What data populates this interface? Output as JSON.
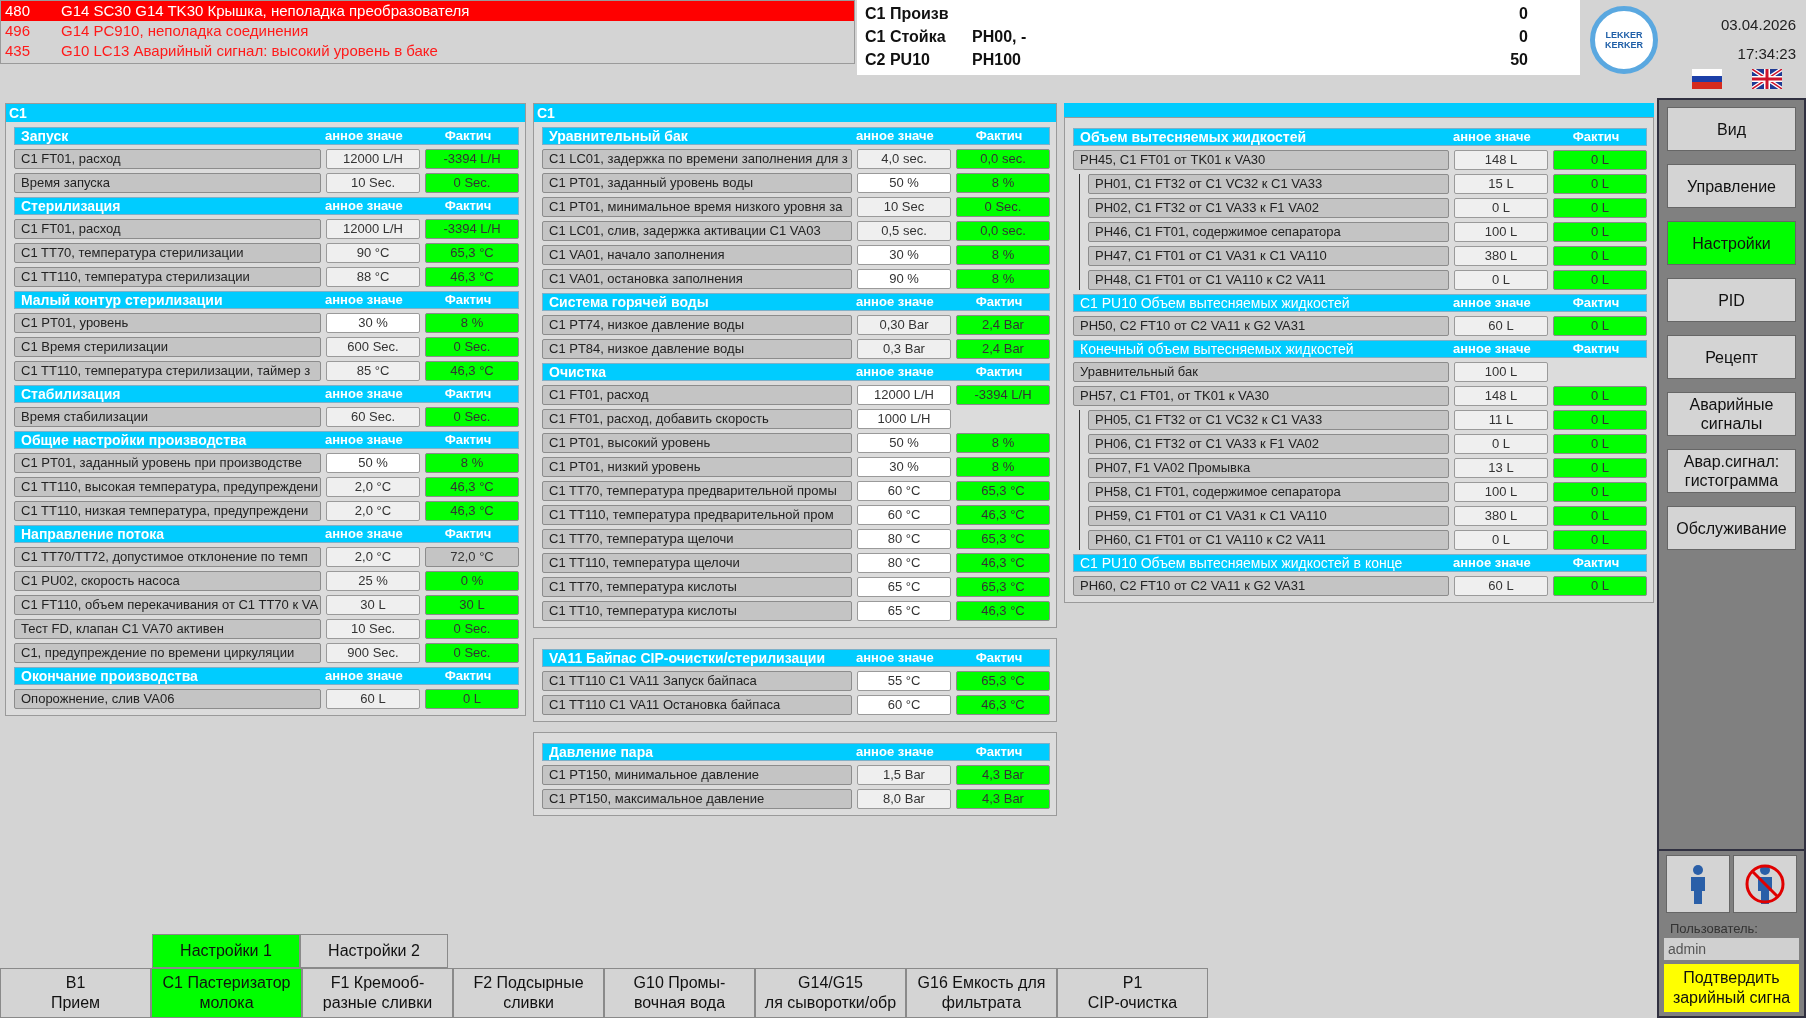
{
  "alarms": [
    {
      "code": "480",
      "text": "G14 SC30 G14 TK30 Крышка, неполадка преобразователя",
      "active": true
    },
    {
      "code": "496",
      "text": "G14 PC910, неполадка соединения",
      "active": false
    },
    {
      "code": "435",
      "text": "G10 LC13 Аварийный сигнал: высокий уровень в баке",
      "active": false
    }
  ],
  "info": [
    {
      "label": "C1 Произв",
      "number": "0"
    },
    {
      "label": "C1 Стойка",
      "value": "PH00, -",
      "number": "0"
    },
    {
      "label": "C2 PU10",
      "value": "PH100",
      "number": "50"
    }
  ],
  "logo": "LEKKER\nKERKER",
  "date": "03.04.2026",
  "time": "17:34:23",
  "columns": [
    [
      {
        "title": "C1",
        "sections": [
          {
            "title": "Запуск",
            "kind": "main",
            "col_set": "анное значе",
            "col_actual": "Фактич",
            "rows": [
              {
                "label": "C1 FT01, расход",
                "set": "12000 L/H",
                "editable": false,
                "actual": "-3394 L/H",
                "ok": true
              },
              {
                "label": "Время запуска",
                "set": "10 Sec.",
                "editable": false,
                "actual": "0 Sec.",
                "ok": true
              }
            ]
          },
          {
            "title": "Стерилизация",
            "kind": "main",
            "col_set": "анное значе",
            "col_actual": "Фактич",
            "rows": [
              {
                "label": "C1 FT01, расход",
                "set": "12000 L/H",
                "editable": false,
                "actual": "-3394 L/H",
                "ok": true
              },
              {
                "label": "C1 TT70, температура стерилизации",
                "set": "90 °C",
                "editable": false,
                "actual": "65,3 °C",
                "ok": true
              },
              {
                "label": "C1 TT110, температура стерилизации",
                "set": "88 °C",
                "editable": false,
                "actual": "46,3 °C",
                "ok": true
              }
            ]
          },
          {
            "title": "Малый контур стерилизации",
            "kind": "main",
            "col_set": "анное значе",
            "col_actual": "Фактич",
            "rows": [
              {
                "label": "C1 PT01, уровень",
                "set": "30 %",
                "editable": true,
                "actual": "8 %",
                "ok": true
              },
              {
                "label": "C1 Время стерилизации",
                "set": "600 Sec.",
                "editable": false,
                "actual": "0 Sec.",
                "ok": true
              },
              {
                "label": "C1 TT110, температура стерилизации, таймер з",
                "set": "85 °C",
                "editable": false,
                "actual": "46,3 °C",
                "ok": true
              }
            ]
          },
          {
            "title": "Стабилизация",
            "kind": "main",
            "col_set": "анное значе",
            "col_actual": "Фактич",
            "rows": [
              {
                "label": "Время стабилизации",
                "set": "60 Sec.",
                "editable": false,
                "actual": "0 Sec.",
                "ok": true
              }
            ]
          },
          {
            "title": "Общие настройки производства",
            "kind": "main",
            "col_set": "анное значе",
            "col_actual": "Фактич",
            "rows": [
              {
                "label": "C1 PT01, заданный уровень при производстве",
                "set": "50 %",
                "editable": true,
                "actual": "8 %",
                "ok": true
              },
              {
                "label": "C1 TT110, высокая температура, предупреждени",
                "set": "2,0 °C",
                "editable": false,
                "actual": "46,3 °C",
                "ok": true
              },
              {
                "label": "C1 TT110, низкая температура, предупреждени",
                "set": "2,0 °C",
                "editable": false,
                "actual": "46,3 °C",
                "ok": true
              }
            ]
          },
          {
            "title": "Направление потока",
            "kind": "main",
            "col_set": "анное значе",
            "col_actual": "Фактич",
            "rows": [
              {
                "label": "C1 TT70/TT72, допустимое отклонение по темп",
                "set": "2,0 °C",
                "editable": false,
                "actual": "72,0 °C",
                "ok": false
              },
              {
                "label": "C1 PU02, скорость насоса",
                "set": "25 %",
                "editable": false,
                "actual": "0 %",
                "ok": true
              },
              {
                "label": "C1 FT110, объем перекачивания от C1 TT70 к VA",
                "set": "30 L",
                "editable": false,
                "actual": "30 L",
                "ok": true
              },
              {
                "label": "Тест FD, клапан C1 VA70 активен",
                "set": "10 Sec.",
                "editable": false,
                "actual": "0 Sec.",
                "ok": true
              },
              {
                "label": "C1, предупреждение по времени циркуляции",
                "set": "900 Sec.",
                "editable": false,
                "actual": "0 Sec.",
                "ok": true
              }
            ]
          },
          {
            "title": "Окончание производства",
            "kind": "main",
            "col_set": "анное значе",
            "col_actual": "Фактич",
            "rows": [
              {
                "label": "Опорожнение, слив VA06",
                "set": "60 L",
                "editable": false,
                "actual": "0 L",
                "ok": true
              }
            ]
          }
        ]
      }
    ],
    [
      {
        "title": "C1",
        "sections": [
          {
            "title": "Уравнительный бак",
            "kind": "main",
            "col_set": "анное значе",
            "col_actual": "Фактич",
            "rows": [
              {
                "label": "C1 LC01, задержка по времени заполнения для з",
                "set": "4,0 sec.",
                "editable": false,
                "actual": "0,0 sec.",
                "ok": true
              },
              {
                "label": "C1 PT01, заданный уровень воды",
                "set": "50 %",
                "editable": true,
                "actual": "8 %",
                "ok": true
              },
              {
                "label": "C1 PT01, минимальное время низкого уровня за",
                "set": "10 Sec",
                "editable": false,
                "actual": "0 Sec.",
                "ok": true
              },
              {
                "label": "C1 LC01, слив, задержка активации C1 VA03",
                "set": "0,5 sec.",
                "editable": false,
                "actual": "0,0 sec.",
                "ok": true
              },
              {
                "label": "C1 VA01, начало заполнения",
                "set": "30 %",
                "editable": true,
                "actual": "8 %",
                "ok": true
              },
              {
                "label": "C1 VA01, остановка заполнения",
                "set": "90 %",
                "editable": true,
                "actual": "8 %",
                "ok": true
              }
            ]
          },
          {
            "title": "Система горячей воды",
            "kind": "main",
            "col_set": "анное значе",
            "col_actual": "Фактич",
            "rows": [
              {
                "label": "C1 PT74, низкое давление воды",
                "set": "0,30 Bar",
                "editable": false,
                "actual": "2,4 Bar",
                "ok": true
              },
              {
                "label": "C1 PT84, низкое давление воды",
                "set": "0,3 Bar",
                "editable": false,
                "actual": "2,4 Bar",
                "ok": true
              }
            ]
          },
          {
            "title": "Очистка",
            "kind": "main",
            "col_set": "анное значе",
            "col_actual": "Фактич",
            "rows": [
              {
                "label": "C1 FT01, расход",
                "set": "12000 L/H",
                "editable": true,
                "actual": "-3394 L/H",
                "ok": true
              },
              {
                "label": "C1 FT01, расход, добавить скорость",
                "set": "1000 L/H",
                "editable": true
              },
              {
                "label": "C1 PT01, высокий уровень",
                "set": "50 %",
                "editable": true,
                "actual": "8 %",
                "ok": true
              },
              {
                "label": "C1 PT01, низкий уровень",
                "set": "30 %",
                "editable": true,
                "actual": "8 %",
                "ok": true
              },
              {
                "label": "C1 TT70, температура предварительной промы",
                "set": "60 °C",
                "editable": true,
                "actual": "65,3 °C",
                "ok": true
              },
              {
                "label": "C1 TT110, температура предварительной пром",
                "set": "60 °C",
                "editable": true,
                "actual": "46,3 °C",
                "ok": true
              },
              {
                "label": "C1 TT70, температура щелочи",
                "set": "80 °C",
                "editable": true,
                "actual": "65,3 °C",
                "ok": true
              },
              {
                "label": "C1 TT110, температура щелочи",
                "set": "80 °C",
                "editable": true,
                "actual": "46,3 °C",
                "ok": true
              },
              {
                "label": "C1 TT70, температура кислоты",
                "set": "65 °C",
                "editable": true,
                "actual": "65,3 °C",
                "ok": true
              },
              {
                "label": "C1 TT10, температура кислоты",
                "set": "65 °C",
                "editable": true,
                "actual": "46,3 °C",
                "ok": true
              }
            ]
          }
        ]
      },
      {
        "sections": [
          {
            "title": "VA11 Байпас CIP-очистки/стерилизации",
            "kind": "main",
            "col_set": "анное значе",
            "col_actual": "Фактич",
            "rows": [
              {
                "label": "C1 TT110 C1 VA11 Запуск байпаса",
                "set": "55 °C",
                "editable": true,
                "actual": "65,3 °C",
                "ok": true
              },
              {
                "label": "C1 TT110 C1 VA11 Остановка байпаса",
                "set": "60 °C",
                "editable": true,
                "actual": "46,3 °C",
                "ok": true
              }
            ]
          }
        ]
      },
      {
        "sections": [
          {
            "title": "Давление пара",
            "kind": "main",
            "col_set": "анное значе",
            "col_actual": "Фактич",
            "rows": [
              {
                "label": "C1 PT150, минимальное давление",
                "set": "1,5 Bar",
                "editable": false,
                "actual": "4,3 Bar",
                "ok": true
              },
              {
                "label": "C1 PT150, максимальное давление",
                "set": "8,0 Bar",
                "editable": false,
                "actual": "4,3 Bar",
                "ok": true
              }
            ]
          }
        ]
      }
    ],
    [
      {
        "sections": [
          {
            "title": "Объем вытесняемых жидкостей",
            "kind": "main",
            "col_set": "анное значе",
            "col_actual": "Фактич",
            "rows": [
              {
                "label": "PH45, C1 FT01 от TK01 к VA30",
                "set": "148 L",
                "editable": false,
                "actual": "0 L",
                "ok": true,
                "children": [
                  {
                    "label": "PH01, C1 FT32 от C1 VC32 к C1 VA33",
                    "set": "15 L",
                    "editable": false,
                    "actual": "0 L",
                    "ok": true
                  },
                  {
                    "label": "PH02, C1 FT32 от C1 VA33 к F1 VA02",
                    "set": "0 L",
                    "editable": false,
                    "actual": "0 L",
                    "ok": true
                  },
                  {
                    "label": "PH46, C1 FT01, содержимое сепаратора",
                    "set": "100 L",
                    "editable": false,
                    "actual": "0 L",
                    "ok": true
                  },
                  {
                    "label": "PH47, C1 FT01 от C1 VA31 к C1 VA110",
                    "set": "380 L",
                    "editable": false,
                    "actual": "0 L",
                    "ok": true
                  },
                  {
                    "label": "PH48, C1 FT01 от C1 VA110 к C2 VA11",
                    "set": "0 L",
                    "editable": false,
                    "actual": "0 L",
                    "ok": true
                  }
                ]
              }
            ]
          },
          {
            "title": "C1 PU10 Объем вытесняемых жидкостей",
            "kind": "sub",
            "col_set": "анное значе",
            "col_actual": "Фактич",
            "rows": [
              {
                "label": "PH50, C2 FT10 от C2 VA11 к G2 VA31",
                "set": "60 L",
                "editable": false,
                "actual": "0 L",
                "ok": true
              }
            ]
          },
          {
            "title": "Конечный объем вытесняемых жидкостей",
            "kind": "sub",
            "col_set": "анное значе",
            "col_actual": "Фактич",
            "rows": [
              {
                "label": "Уравнительный бак",
                "set": "100 L",
                "editable": false
              },
              {
                "label": "PH57, C1 FT01, от TK01 к VA30",
                "set": "148 L",
                "editable": false,
                "actual": "0 L",
                "ok": true,
                "children": [
                  {
                    "label": "PH05, C1 FT32 от C1 VC32 к C1 VA33",
                    "set": "11 L",
                    "editable": false,
                    "actual": "0 L",
                    "ok": true
                  },
                  {
                    "label": "PH06, C1 FT32 от C1 VA33 к F1 VA02",
                    "set": "0 L",
                    "editable": false,
                    "actual": "0 L",
                    "ok": true
                  },
                  {
                    "label": "PH07, F1 VA02 Промывка",
                    "set": "13 L",
                    "editable": false,
                    "actual": "0 L",
                    "ok": true
                  },
                  {
                    "label": "PH58, C1 FT01, содержимое сепаратора",
                    "set": "100 L",
                    "editable": false,
                    "actual": "0 L",
                    "ok": true
                  },
                  {
                    "label": "PH59, C1 FT01 от C1 VA31 к C1 VA110",
                    "set": "380 L",
                    "editable": false,
                    "actual": "0 L",
                    "ok": true
                  },
                  {
                    "label": "PH60, C1 FT01 от C1 VA110 к C2 VA11",
                    "set": "0 L",
                    "editable": false,
                    "actual": "0 L",
                    "ok": true
                  }
                ]
              }
            ]
          },
          {
            "title": "C1 PU10 Объем вытесняемых жидкостей в конце",
            "kind": "sub",
            "col_set": "анное значе",
            "col_actual": "Фактич",
            "rows": [
              {
                "label": "PH60, C2 FT10 от C2 VA11 к G2 VA31",
                "set": "60 L",
                "editable": false,
                "actual": "0 L",
                "ok": true
              }
            ]
          }
        ]
      }
    ]
  ],
  "sub_tabs": [
    {
      "label": "Настройки 1",
      "selected": true
    },
    {
      "label": "Настройки 2",
      "selected": false
    }
  ],
  "area_tabs": [
    {
      "label": "B1\nПрием",
      "selected": false
    },
    {
      "label": "C1 Пастеризатор\nмолока",
      "selected": true
    },
    {
      "label": "F1 Кремооб-\nразные сливки",
      "selected": false
    },
    {
      "label": "F2 Подсырные\nсливки",
      "selected": false
    },
    {
      "label": "G10 Промы-\nвочная вода",
      "selected": false
    },
    {
      "label": "G14/G15\nля сыворотки/обр",
      "selected": false
    },
    {
      "label": "G16 Емкость для\nфильтрата",
      "selected": false
    },
    {
      "label": "P1\nCIP-очистка",
      "selected": false
    }
  ],
  "sidebar": {
    "buttons": [
      {
        "label": "Вид",
        "selected": false
      },
      {
        "label": "Управление",
        "selected": false
      },
      {
        "label": "Настройки",
        "selected": true
      },
      {
        "label": "PID",
        "selected": false
      },
      {
        "label": "Рецепт",
        "selected": false
      },
      {
        "label": "Аварийные\nсигналы",
        "selected": false
      },
      {
        "label": "Авар.сигнал:\nгистограмма",
        "selected": false
      },
      {
        "label": "Обслуживание",
        "selected": false
      }
    ],
    "user_label": "Пользователь:",
    "user": "admin",
    "confirm": "Подтвердить\nзарийный сигна"
  }
}
